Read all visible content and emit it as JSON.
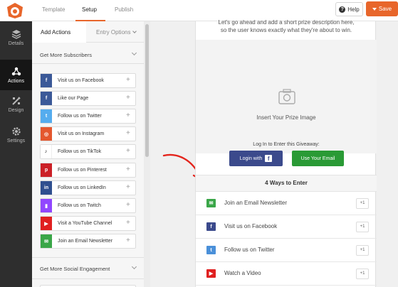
{
  "topbar": {
    "tabs": [
      {
        "label": "Template"
      },
      {
        "label": "Setup"
      },
      {
        "label": "Publish"
      }
    ],
    "help_label": "Help",
    "save_label": "Save",
    "accent_color": "#e8662b"
  },
  "leftnav": {
    "items": [
      {
        "label": "Details",
        "icon": "layers-icon"
      },
      {
        "label": "Actions",
        "icon": "network-icon",
        "active": true
      },
      {
        "label": "Design",
        "icon": "design-icon"
      },
      {
        "label": "Settings",
        "icon": "gear-icon"
      }
    ]
  },
  "panel": {
    "tabs": [
      {
        "label": "Add Actions"
      },
      {
        "label": "Entry Options"
      }
    ],
    "sections": [
      {
        "title": "Get More Subscribers"
      },
      {
        "title": "Get More Social Engagement"
      }
    ],
    "actions": [
      {
        "label": "Visit us on Facebook",
        "icon": "facebook-icon",
        "color": "#3b5998"
      },
      {
        "label": "Like our Page",
        "icon": "facebook-icon",
        "color": "#3b5998"
      },
      {
        "label": "Follow us on Twitter",
        "icon": "twitter-icon",
        "color": "#55acee"
      },
      {
        "label": "Visit us on Instagram",
        "icon": "instagram-icon",
        "color": "#e4572e"
      },
      {
        "label": "Follow us on TikTok",
        "icon": "tiktok-icon",
        "color": "#ffffff"
      },
      {
        "label": "Follow us on Pinterest",
        "icon": "pinterest-icon",
        "color": "#cb2027"
      },
      {
        "label": "Follow us on LinkedIn",
        "icon": "linkedin-icon",
        "color": "#2f4f8f"
      },
      {
        "label": "Follow us on Twitch",
        "icon": "twitch-icon",
        "color": "#9146ff"
      },
      {
        "label": "Visit a YouTube Channel",
        "icon": "youtube-icon",
        "color": "#e02020"
      },
      {
        "label": "Join an Email Newsletter",
        "icon": "email-icon",
        "color": "#3aa648"
      }
    ],
    "plus": "+"
  },
  "preview": {
    "description_line1": "Let's go ahead and add a short prize description here,",
    "description_line2": "so the user knows exactly what they're about to win.",
    "image_label": "Insert Your Prize Image",
    "login_text": "Log In to Enter this Giveaway:",
    "facebook_login": "Login with",
    "email_login": "Use Your Email",
    "ways_title": "4 Ways to Enter",
    "entries": [
      {
        "label": "Join an Email Newsletter",
        "points": "+1",
        "icon": "email-icon",
        "color": "#3aa648"
      },
      {
        "label": "Visit us on Facebook",
        "points": "+1",
        "icon": "facebook-icon",
        "color": "#3b4a8c"
      },
      {
        "label": "Follow us on Twitter",
        "points": "+1",
        "icon": "twitter-icon",
        "color": "#4a90d9"
      },
      {
        "label": "Watch a Video",
        "points": "+1",
        "icon": "youtube-icon",
        "color": "#e02020"
      }
    ]
  }
}
